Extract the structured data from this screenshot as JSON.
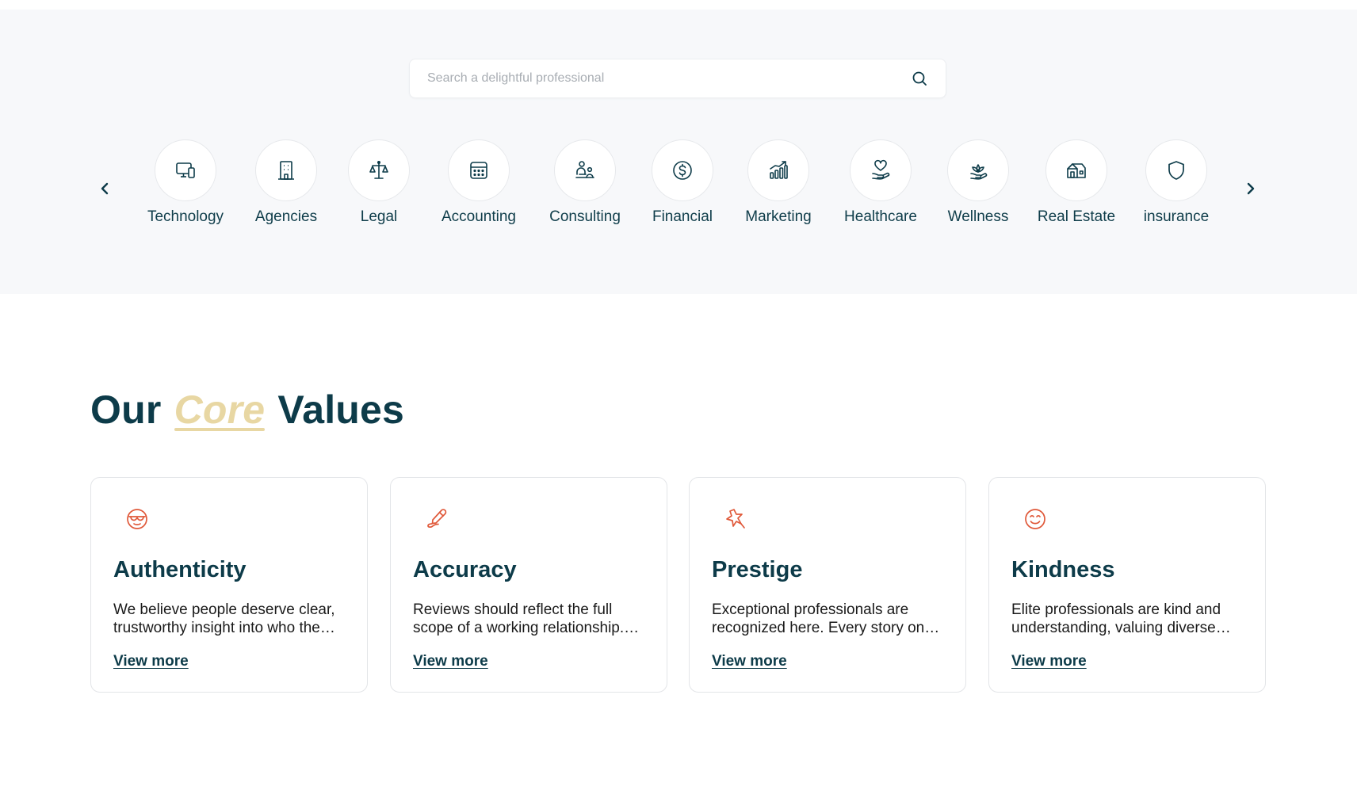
{
  "colors": {
    "brand_dark": "#0d3b49",
    "accent_gold": "#e8d7a3",
    "icon_orange": "#e0593a",
    "hero_bg": "#f7f8fa"
  },
  "search": {
    "placeholder": "Search a delightful professional",
    "icon": "search-icon"
  },
  "categories": [
    {
      "label": "Technology",
      "icon": "devices-icon"
    },
    {
      "label": "Agencies",
      "icon": "building-icon"
    },
    {
      "label": "Legal",
      "icon": "scales-icon"
    },
    {
      "label": "Accounting",
      "icon": "calculator-icon"
    },
    {
      "label": "Consulting",
      "icon": "consulting-icon"
    },
    {
      "label": "Financial",
      "icon": "dollar-coin-icon"
    },
    {
      "label": "Marketing",
      "icon": "growth-chart-icon"
    },
    {
      "label": "Healthcare",
      "icon": "heart-hand-icon"
    },
    {
      "label": "Wellness",
      "icon": "lotus-icon"
    },
    {
      "label": "Real Estate",
      "icon": "house-icon"
    },
    {
      "label": "insurance",
      "icon": "shield-icon"
    }
  ],
  "core_values": {
    "title_before": "Our",
    "title_accent": "Core",
    "title_after": "Values",
    "cards": [
      {
        "icon": "mask-face-icon",
        "title": "Authenticity",
        "text": "We believe people deserve clear, trustworthy insight into who the…",
        "link": "View more"
      },
      {
        "icon": "pen-icon",
        "title": "Accuracy",
        "text": "Reviews should reflect the full scope of a working relationship.…",
        "link": "View more"
      },
      {
        "icon": "star-burst-icon",
        "title": "Prestige",
        "text": "Exceptional professionals are recognized here. Every story on…",
        "link": "View more"
      },
      {
        "icon": "smile-face-icon",
        "title": "Kindness",
        "text": "Elite professionals are kind and understanding, valuing diverse…",
        "link": "View more"
      }
    ]
  }
}
